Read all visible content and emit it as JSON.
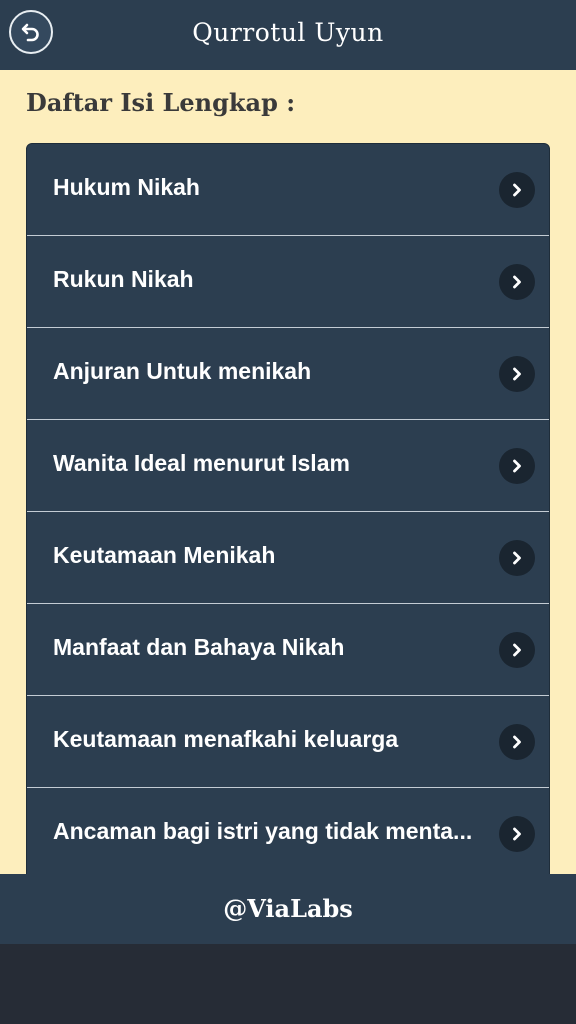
{
  "header": {
    "title": "Qurrotul Uyun",
    "back_icon": "undo-arrow-icon"
  },
  "section_title": "Daftar Isi Lengkap :",
  "menu_items": [
    {
      "label": "Hukum Nikah"
    },
    {
      "label": "Rukun Nikah"
    },
    {
      "label": "Anjuran Untuk menikah"
    },
    {
      "label": "Wanita Ideal menurut Islam"
    },
    {
      "label": "Keutamaan Menikah"
    },
    {
      "label": "Manfaat dan Bahaya Nikah"
    },
    {
      "label": "Keutamaan menafkahi keluarga"
    },
    {
      "label": "Ancaman bagi istri yang tidak menta..."
    }
  ],
  "footer": {
    "text": "@ViaLabs"
  },
  "colors": {
    "header_bg": "#2c3e50",
    "content_bg": "#fdeebd",
    "list_bg": "#2c3e50",
    "chevron_bg": "#1a2530"
  }
}
